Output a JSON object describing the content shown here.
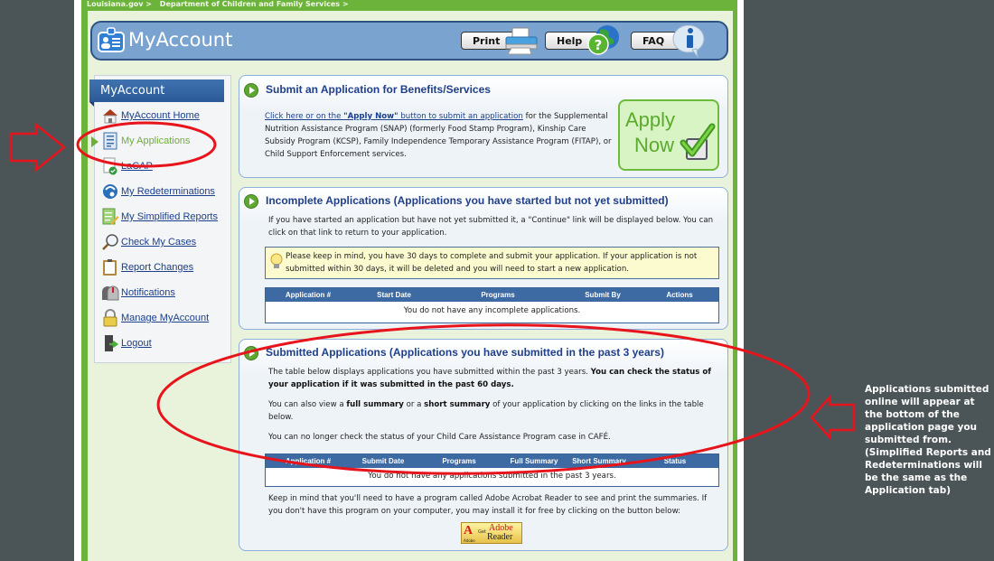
{
  "breadcrumb": [
    "Louisiana.gov >",
    "Department of Children and Family Services >"
  ],
  "header": {
    "logo_text": "MyAccount",
    "buttons": {
      "print": "Print",
      "help": "Help",
      "faq": "FAQ"
    }
  },
  "sidebar": {
    "title": "MyAccount",
    "items": [
      {
        "label": "MyAccount Home",
        "icon": "home-icon",
        "active": false
      },
      {
        "label": "My Applications",
        "icon": "document-icon",
        "active": true
      },
      {
        "label": "LaCAP",
        "icon": "document-check-icon",
        "active": false
      },
      {
        "label": "My Redeterminations",
        "icon": "redetermination-icon",
        "active": false
      },
      {
        "label": "My Simplified Reports",
        "icon": "report-pencil-icon",
        "active": false
      },
      {
        "label": "Check My Cases",
        "icon": "magnifier-icon",
        "active": false
      },
      {
        "label": "Report Changes",
        "icon": "clipboard-icon",
        "active": false
      },
      {
        "label": "Notifications",
        "icon": "mailbox-icon",
        "active": false
      },
      {
        "label": "Manage MyAccount",
        "icon": "lock-icon",
        "active": false
      },
      {
        "label": "Logout",
        "icon": "logout-door-icon",
        "active": false
      }
    ]
  },
  "submit_panel": {
    "title": "Submit an Application for Benefits/Services",
    "link_pre": "Click here or on the ",
    "link_bold": "\"Apply Now\"",
    "link_post": " button to submit an application",
    "text": " for the Supplemental Nutrition Assistance Program (SNAP) (formerly Food Stamp Program), Kinship Care Subsidy Program (KCSP), Family Independence Temporary Assistance Program (FITAP), or Child Support Enforcement services.",
    "apply_button": {
      "line1": "Apply",
      "line2": "Now"
    }
  },
  "incomplete_panel": {
    "title": "Incomplete Applications (Applications you have started but not yet submitted)",
    "text": "If you have started an application but have not yet submitted it, a \"Continue\" link will be displayed below. You can click on that link to return to your application.",
    "note": "Please keep in mind, you have 30 days to complete and submit your application. If your application is not submitted within 30 days, it will be deleted and you will need to start a new application.",
    "columns": [
      "Application #",
      "Start Date",
      "Programs",
      "Submit By",
      "Actions"
    ],
    "empty_message": "You do not have any incomplete applications."
  },
  "submitted_panel": {
    "title": "Submitted Applications (Applications you have submitted in the past 3 years)",
    "p1_normal": "The table below displays applications you have submitted within the past 3 years. ",
    "p1_bold": "You can check the status of your application if it was submitted in the past 60 days.",
    "p2_a": "You can also view a ",
    "p2_b": "full summary",
    "p2_c": " or a ",
    "p2_d": "short summary",
    "p2_e": " of your application by clicking on the links in the table below.",
    "p3": "You can no longer check the status of your Child Care Assistance Program case in CAFÉ.",
    "columns": [
      "Application #",
      "Submit Date",
      "Programs",
      "Full Summary",
      "Short Summary",
      "Status"
    ],
    "empty_message": "You do not have any applications submitted in the past 3 years.",
    "footer": "Keep in mind that you'll need to have a program called Adobe Acrobat Reader to see and print the summaries. If you don't have this program on your computer, you may install it for free by clicking on the button below:",
    "adobe": {
      "get": "Get",
      "adobe": "Adobe",
      "reader": "Reader",
      "brand": "Adobe"
    }
  },
  "annotation": {
    "text": "Applications submitted online will appear at the bottom of the application page you submitted from. (Simplified Reports and Redeterminations will be the same as the Application tab)",
    "color": "#e8141c"
  },
  "colors": {
    "page_bg": "#4b5558",
    "frame_green": "#6bb33b",
    "content_bg": "#e9f3dc",
    "header_blue": "#7aa3cf",
    "title_blue": "#1f3f8a",
    "table_header": "#3d6aa3",
    "active_green": "#6fae3b"
  }
}
